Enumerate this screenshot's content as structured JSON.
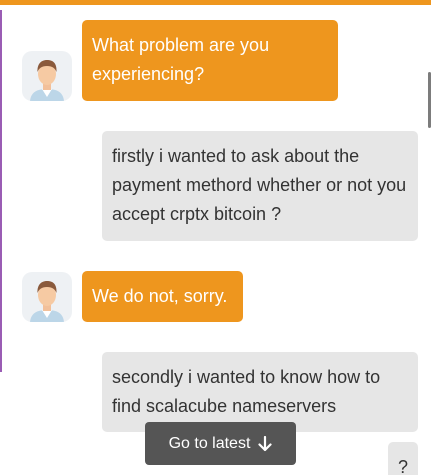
{
  "colors": {
    "accent": "#ee961e",
    "user_bubble": "#e6e6e6",
    "latest_button": "#555555"
  },
  "messages": [
    {
      "sender": "bot",
      "text": "What problem are you experiencing?"
    },
    {
      "sender": "user",
      "text": "firstly i wanted to ask about the payment methord whether or not you accept crptx bitcoin ?"
    },
    {
      "sender": "bot",
      "text": "We do not, sorry."
    },
    {
      "sender": "user",
      "text": "secondly i wanted to know how to find scalacube nameservers"
    },
    {
      "sender": "user",
      "text": "?"
    }
  ],
  "go_latest": {
    "label": "Go to latest",
    "icon": "arrow-down-icon"
  }
}
